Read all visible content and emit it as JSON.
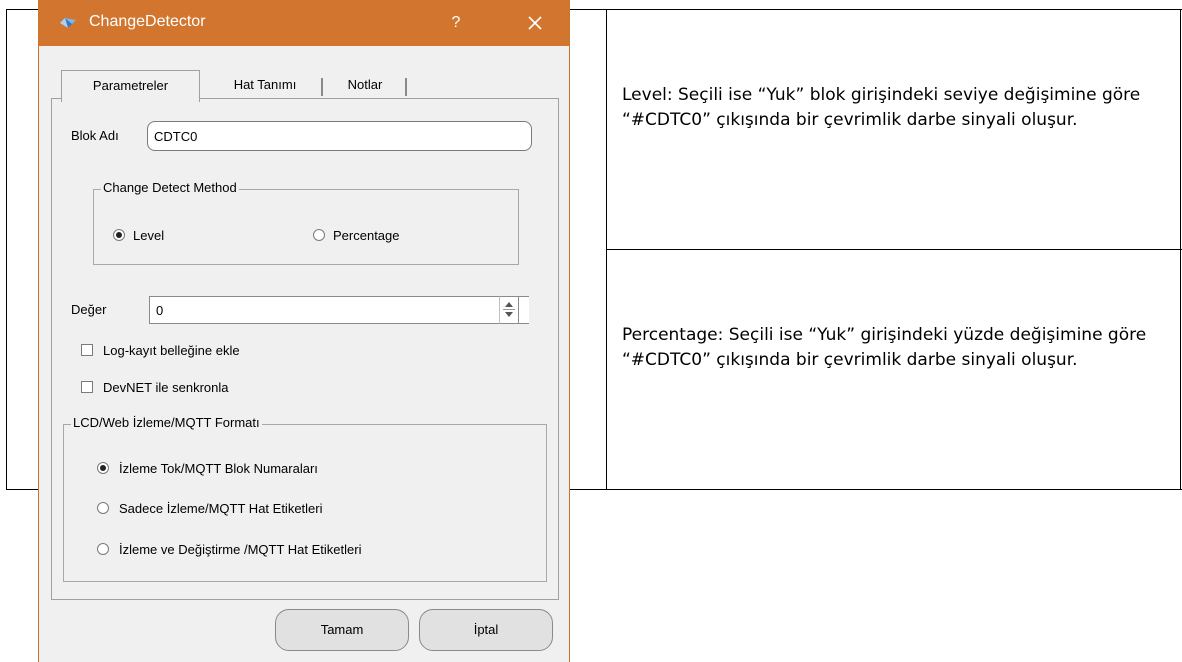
{
  "dialog": {
    "title": "ChangeDetector",
    "help_label": "?",
    "tabs": [
      {
        "label": "Parametreler",
        "active": true
      },
      {
        "label": "Hat Tanımı",
        "active": false
      },
      {
        "label": "Notlar",
        "active": false
      }
    ],
    "block_name": {
      "label": "Blok Adı",
      "value": "CDTC0"
    },
    "change_detect_method": {
      "title": "Change Detect Method",
      "options": [
        {
          "label": "Level",
          "selected": true
        },
        {
          "label": "Percentage",
          "selected": false
        }
      ]
    },
    "value_field": {
      "label": "Değer",
      "value": "0"
    },
    "checkboxes": [
      {
        "label": "Log-kayıt belleğine ekle",
        "checked": false
      },
      {
        "label": "DevNET ile senkronla",
        "checked": false
      }
    ],
    "lcd_format": {
      "title": "LCD/Web İzleme/MQTT Formatı",
      "options": [
        {
          "label": "İzleme Tok/MQTT Blok Numaraları",
          "selected": true
        },
        {
          "label": "Sadece İzleme/MQTT Hat Etiketleri",
          "selected": false
        },
        {
          "label": "İzleme ve Değiştirme /MQTT Hat Etiketleri",
          "selected": false
        }
      ]
    },
    "buttons": {
      "ok": "Tamam",
      "cancel": "İptal"
    },
    "colors": {
      "titlebar": "#d2762f",
      "window_bg": "#f0f0f0"
    }
  },
  "document": {
    "rows": [
      {
        "text": "Level:  Seçili ise “Yuk” blok girişindeki seviye değişimine göre “#CDTC0” çıkışında bir çevrimlik darbe sinyali oluşur."
      },
      {
        "text": "Percentage:  Seçili ise “Yuk” girişindeki yüzde değişimine göre “#CDTC0” çıkışında bir çevrimlik darbe sinyali oluşur."
      }
    ]
  }
}
